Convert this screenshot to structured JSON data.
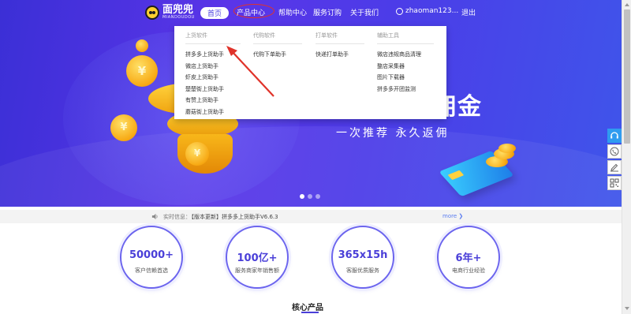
{
  "brand": {
    "name_cn": "面兜兜",
    "name_en": "MIANDOUDOU"
  },
  "nav": {
    "home": "首页",
    "products": "产品中心",
    "help": "帮助中心",
    "service": "服务订购",
    "about": "关于我们",
    "username": "zhaoman123...",
    "logout": "退出"
  },
  "dropdown": {
    "columns": [
      {
        "heading": "上货软件",
        "items": [
          "拼多多上货助手",
          "微店上货助手",
          "虾皮上货助手",
          "楚楚街上货助手",
          "有赞上货助手",
          "蘑菇街上货助手"
        ]
      },
      {
        "heading": "代购软件",
        "items": [
          "代购下单助手"
        ]
      },
      {
        "heading": "打单软件",
        "items": [
          "快递打单助手"
        ]
      },
      {
        "heading": "辅助工具",
        "items": [
          "微店违规商品清理",
          "整店采集器",
          "图片下载器",
          "拼多多开团监测"
        ]
      }
    ]
  },
  "hero": {
    "title": "佣金",
    "subtitle": "一次推荐    永久返佣"
  },
  "ticker": {
    "label": "实时信息：",
    "text": "【版本更新】拼多多上货助手V6.6.3",
    "more": "more ❯"
  },
  "stats": [
    {
      "value": "50000+",
      "label": "客户信赖首选"
    },
    {
      "value": "100亿+",
      "label": "服务商家年销售额"
    },
    {
      "value": "365x15h",
      "label": "客服优质服务"
    },
    {
      "value": "6年+",
      "label": "电商行业经验"
    }
  ],
  "section": {
    "title": "核心产品"
  },
  "float_bar": {
    "icons": [
      "headset-icon",
      "phone-icon",
      "edit-icon",
      "qr-code-icon"
    ]
  },
  "colors": {
    "hero_start": "#3b2fd6",
    "hero_end": "#3f55ea",
    "accent": "#4a3fd8",
    "highlight_circle": "#e0332a"
  }
}
